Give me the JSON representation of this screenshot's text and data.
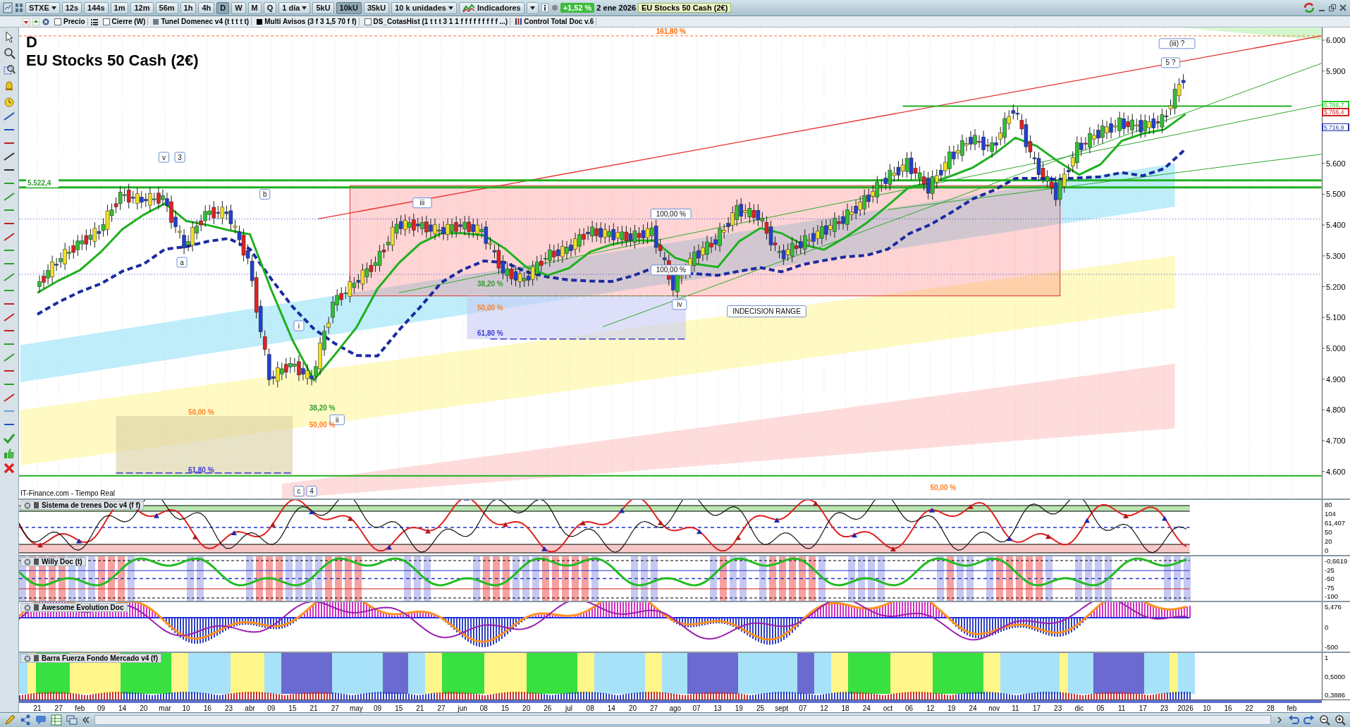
{
  "toolbar": {
    "symbol": "STXE",
    "periods": [
      {
        "label": "12s",
        "selected": false
      },
      {
        "label": "144s",
        "selected": false
      },
      {
        "label": "1m",
        "selected": false
      },
      {
        "label": "12m",
        "selected": false
      },
      {
        "label": "56m",
        "selected": false
      },
      {
        "label": "1h",
        "selected": false
      },
      {
        "label": "4h",
        "selected": false
      },
      {
        "label": "D",
        "selected": true
      },
      {
        "label": "W",
        "selected": false
      },
      {
        "label": "M",
        "selected": false
      },
      {
        "label": "Q",
        "selected": false
      }
    ],
    "interval": "1 día",
    "units": [
      {
        "label": "5kU",
        "selected": false
      },
      {
        "label": "10kU",
        "selected": true
      },
      {
        "label": "35kU",
        "selected": false
      }
    ],
    "unit_size": "10 k unidades",
    "indicators_button": "Indicadores",
    "change": "+1,52 %",
    "date": "2 ene 2026",
    "instrument": "EU Stocks 50 Cash (2€)"
  },
  "overlays": [
    {
      "kind": "checkbox",
      "label": "Precio",
      "checked": false
    },
    {
      "kind": "list_icon"
    },
    {
      "kind": "checkbox",
      "label": "Cierre (W)",
      "checked": false
    },
    {
      "kind": "swatch",
      "label": "Tunel Domenec v4 (t t t t t)",
      "color": "#6e7c88"
    },
    {
      "kind": "swatch",
      "label": "Multi Avisos (3 f 3 1,5 70 f f)",
      "color": "#000000"
    },
    {
      "kind": "checkbox",
      "label": "DS_CotasHist (1 t t t 3 1 1 f f f f f f f f f ...)",
      "checked": false
    },
    {
      "kind": "bars",
      "label": "Control Total Doc v.6"
    }
  ],
  "main_chart": {
    "period_letter": "D",
    "title": "EU Stocks 50 Cash (2€)",
    "source": "IT-Finance.com - Tiempo Real",
    "price_axis": [
      "6.000",
      "5.900",
      "5.600",
      "5.500",
      "5.400",
      "5.300",
      "5.200",
      "5.100",
      "5.000",
      "4.900",
      "4.800",
      "4.700",
      "4.600"
    ],
    "price_tags": [
      {
        "text": "5.786,7",
        "color": "#22cc22"
      },
      {
        "text": "5.766,4",
        "color": "#cc2222"
      },
      {
        "text": "5.716,9",
        "color": "#2233aa"
      }
    ],
    "labels": [
      {
        "kind": "fib",
        "text": "161,80 %",
        "color": "#ff6a00"
      },
      {
        "kind": "box",
        "text": "(iii) ?"
      },
      {
        "kind": "box",
        "text": "5 ?"
      },
      {
        "kind": "box",
        "text": "v"
      },
      {
        "kind": "box",
        "text": "3"
      },
      {
        "kind": "box",
        "text": "b"
      },
      {
        "kind": "box",
        "text": "a"
      },
      {
        "kind": "box",
        "text": "iii"
      },
      {
        "kind": "box",
        "text": "100,00 %"
      },
      {
        "kind": "box",
        "text": "100,00 %"
      },
      {
        "kind": "fib",
        "text": "38,20 %",
        "color": "#2e9e2e"
      },
      {
        "kind": "fib",
        "text": "50,00 %",
        "color": "#ff7f27"
      },
      {
        "kind": "fib",
        "text": "61,80 %",
        "color": "#3a3ad0"
      },
      {
        "kind": "box",
        "text": "iv"
      },
      {
        "kind": "note",
        "text": "INDECISION RANGE"
      },
      {
        "kind": "box",
        "text": "i"
      },
      {
        "kind": "fib",
        "text": "38,20 %",
        "color": "#2e9e2e"
      },
      {
        "kind": "box",
        "text": "ii"
      },
      {
        "kind": "fib",
        "text": "50,00 %",
        "color": "#ff7f27"
      },
      {
        "kind": "fib",
        "text": "50,00 %",
        "color": "#ff7f27"
      },
      {
        "kind": "fib",
        "text": "61,80 %",
        "color": "#3a3ad0"
      },
      {
        "kind": "box",
        "text": "c"
      },
      {
        "kind": "box",
        "text": "4"
      },
      {
        "kind": "fib",
        "text": "50,00 %",
        "color": "#ff7f27"
      },
      {
        "kind": "level",
        "text": "5.522,4",
        "color": "#2e9e2e"
      }
    ]
  },
  "indicators": [
    {
      "kind": "trains",
      "title": "Sistema de trenes Doc v4 (f f)",
      "axis_labels": [
        "80",
        "104",
        "61,407",
        "50",
        "20",
        "0"
      ]
    },
    {
      "kind": "willy",
      "title": "Willy Doc (t)",
      "axis_labels": [
        "-0,6619",
        "-25",
        "-50",
        "-75",
        "-100"
      ]
    },
    {
      "kind": "awesome",
      "title": "Awesome Evolution Doc",
      "axis_labels": [
        "5,476",
        "0",
        "-500"
      ]
    },
    {
      "kind": "barra",
      "title": "Barra Fuerza Fondo Mercado v4 (f)",
      "axis_labels": [
        "1",
        "0,5000",
        "0,3886"
      ]
    }
  ],
  "date_axis": [
    "21",
    "27",
    "feb",
    "09",
    "14",
    "20",
    "mar",
    "10",
    "16",
    "23",
    "abr",
    "09",
    "15",
    "21",
    "27",
    "may",
    "09",
    "15",
    "21",
    "27",
    "jun",
    "08",
    "15",
    "20",
    "26",
    "jul",
    "08",
    "14",
    "20",
    "27",
    "ago",
    "07",
    "13",
    "19",
    "25",
    "sept",
    "07",
    "12",
    "18",
    "24",
    "oct",
    "06",
    "12",
    "19",
    "24",
    "nov",
    "11",
    "17",
    "23",
    "dic",
    "05",
    "11",
    "17",
    "23",
    "2026",
    "10",
    "16",
    "22",
    "28",
    "feb"
  ]
}
